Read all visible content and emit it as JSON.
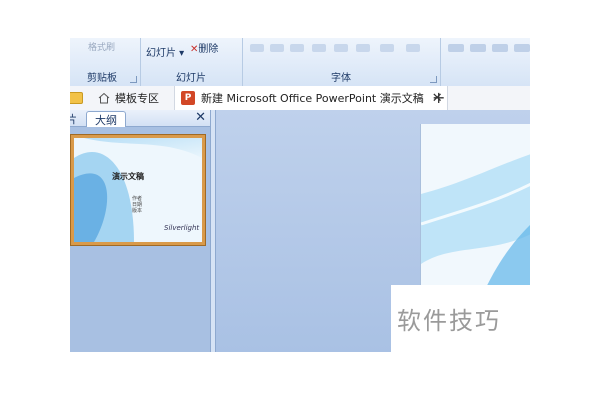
{
  "ribbon": {
    "clipboard": {
      "label": "剪贴板",
      "faded_text": "格式刷"
    },
    "slides": {
      "label": "幻灯片",
      "new_slide": "幻灯片",
      "delete_hint": "删除"
    },
    "font": {
      "label": "字体"
    }
  },
  "tabs": {
    "home_label": "模板专区",
    "doc_label": "新建 Microsoft Office PowerPoint 演示文稿",
    "close": "✕",
    "add": "+"
  },
  "left_pane": {
    "tab_slides": "片",
    "tab_outline": "大纲",
    "close": "✕",
    "thumbnail": {
      "title": "演示文稿",
      "subtitle_lines": [
        "作者",
        "日期",
        "版本"
      ],
      "logo": "Silverlight"
    }
  },
  "watermark": {
    "text": "软件技巧"
  },
  "colors": {
    "accent": "#d24726",
    "ribbon": "#dbe7f7",
    "pane": "#a8c0e2"
  }
}
